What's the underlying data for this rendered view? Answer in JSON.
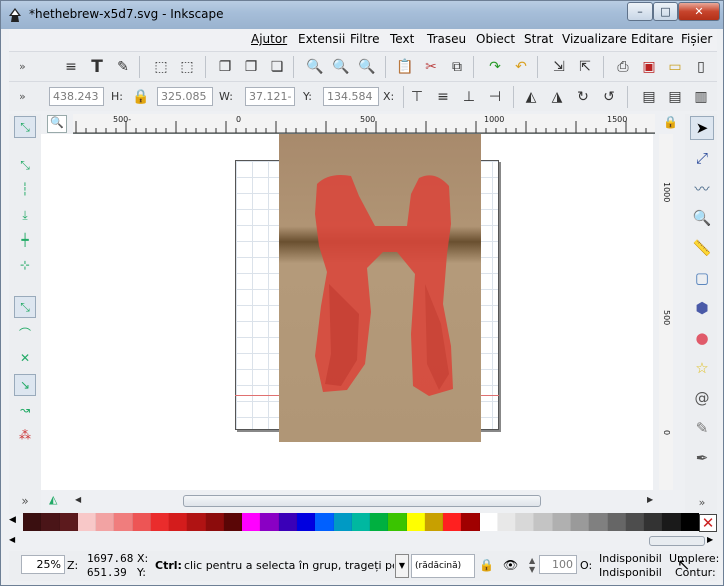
{
  "window": {
    "title": "*hethebrew-x5d7.svg - Inkscape",
    "app_icon": "inkscape-icon"
  },
  "window_buttons": {
    "minimize": "–",
    "maximize": "□",
    "close": "✕"
  },
  "menu": [
    "Ajutor",
    "Extensii",
    "Filtre",
    "Text",
    "Traseu",
    "Obiect",
    "Strat",
    "Vizualizare",
    "Editare",
    "Fișier"
  ],
  "toolbar2": {
    "more": "»"
  },
  "toolbar3": {
    "more": "»",
    "x_value": "438.243",
    "y_label": "H:",
    "y_value": "325.085",
    "w_label": "W:",
    "w_value": "37.121-",
    "h_label": "Y:",
    "h_value": "134.584",
    "x_label": "X:"
  },
  "ruler": {
    "labels": [
      "500-",
      "0",
      "500",
      "1000",
      "1500"
    ],
    "v_labels": [
      "1000",
      "500",
      "0"
    ]
  },
  "palette": [
    "#3a0f10",
    "#4a1518",
    "#5c1a1d",
    "#f8c8c8",
    "#f2a3a3",
    "#f07d7d",
    "#ed5555",
    "#ea2c2c",
    "#d41c1c",
    "#b01313",
    "#8c0c0c",
    "#5a0606",
    "#ff00ff",
    "#8a00c4",
    "#3a00b8",
    "#0000e0",
    "#0060ff",
    "#009ac4",
    "#00b8a0",
    "#00b040",
    "#3ac400",
    "#ffff00",
    "#c8a000",
    "#ff2020",
    "#a00000",
    "#ffffff",
    "#e8e8e8",
    "#d8d8d8",
    "#c4c4c4",
    "#b0b0b0",
    "#9a9a9a",
    "#808080",
    "#666666",
    "#4d4d4d",
    "#333333",
    "#1a1a1a",
    "#000000"
  ],
  "status": {
    "zoom": "25%",
    "z_label": "Z:",
    "coord_x": "1697.68",
    "coord_y": "651.39",
    "x_label": "X:",
    "y_label": "Y:",
    "hint_bold": "Ctrl:",
    "hint": " clic pentru a selecta în grup, trageți pe...",
    "layer": "(rădăcină)",
    "opacity": "100",
    "o_label": "O:",
    "fill_state": "Indisponibil",
    "stroke_state": "Indisponibil",
    "fill_label": "Umplere:",
    "stroke_label": "Contur:"
  }
}
